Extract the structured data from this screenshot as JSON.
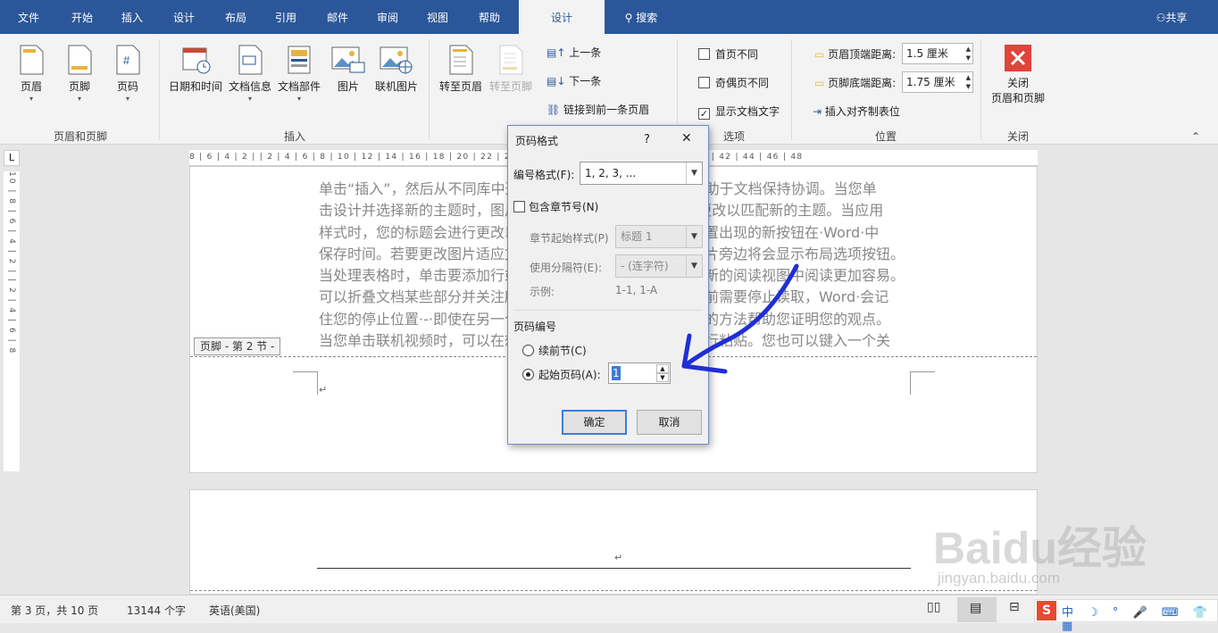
{
  "tabs": [
    "文件",
    "开始",
    "插入",
    "设计",
    "布局",
    "引用",
    "邮件",
    "审阅",
    "视图",
    "帮助",
    "设计"
  ],
  "active_tab_index": 10,
  "search_label": "搜索",
  "share_label": "共享",
  "ribbon": {
    "header_footer": {
      "header": "页眉",
      "footer": "页脚",
      "page_number": "页码",
      "group": "页眉和页脚"
    },
    "insert": {
      "datetime": "日期和时间",
      "docinfo": "文档信息",
      "quickparts": "文档部件",
      "picture": "图片",
      "online_picture": "联机图片",
      "group": "插入"
    },
    "navigation": {
      "goto_header": "转至页眉",
      "goto_footer": "转至页脚",
      "previous": "上一条",
      "next": "下一条",
      "link_previous": "链接到前一条页眉"
    },
    "options": {
      "diff_first": "首页不同",
      "diff_odd_even": "奇偶页不同",
      "show_text": "显示文档文字",
      "group": "选项",
      "show_text_checked": true
    },
    "position": {
      "header_top_label": "页眉顶端距离:",
      "header_top_value": "1.5 厘米",
      "footer_bottom_label": "页脚底端距离:",
      "footer_bottom_value": "1.75 厘米",
      "align_tab": "插入对齐制表位",
      "group": "位置"
    },
    "close": {
      "label1": "关闭",
      "label2": "页眉和页脚",
      "group": "关闭"
    }
  },
  "ruler": "8 | 6 | 4 | 2 |  | 2 | 4 | 6 | 8 | 10 | 12 | 14 | 16 | 18 | 20 | 22 | 24 | 26 | 28 | 30 | 32 | 34 | 36 | 38 | 40 | 42 | 44 | 46 | 48",
  "vruler": "10 | 8 | 6 | 4 | 2 |  | 2 | 4 | 6 | 8",
  "document": {
    "lines": [
      "单击“插入”，然后从不同库中选择所需元素。主题和样式也有助于文档保持协调。当您单",
      "击设计并选择新的主题时，图片、图表或SmartArt图形将会更改以匹配新的主题。当应用",
      "样式时，您的标题会进行更改以匹配新的主题。使用在需要位置出现的新按钮在·Word·中",
      "保存时间。若要更改图片适应文档的方式，请单击该图片，图片旁边将会显示布局选项按钮。",
      "当处理表格时，单击要添加行或列的位置，然后单击加号。在新的阅读视图中阅读更加容易。",
      "可以折叠文档某些部分并关注所需文本。如果在达到结尾处之前需要停止读取，Word·会记",
      "住您的停止位置·-·即使在另一个设备上。视频提供了功能强大的方法帮助您证明您的观点。",
      "当您单击联机视频时，可以在想要添加的视频的嵌入代码中进行粘贴。您也可以键入一个关"
    ],
    "footer_tag": "页脚 - 第 2 节 -",
    "para_mark": "↵"
  },
  "dialog": {
    "title": "页码格式",
    "help": "?",
    "close": "✕",
    "format_label": "编号格式(F):",
    "format_value": "1, 2, 3, ...",
    "include_chapter": "包含章节号(N)",
    "chapter_style_label": "章节起始样式(P)",
    "chapter_style_value": "标题 1",
    "separator_label": "使用分隔符(E):",
    "separator_value": "-  (连字符)",
    "example_label": "示例:",
    "example_value": "1-1, 1-A",
    "numbering_title": "页码编号",
    "continue_label": "续前节(C)",
    "start_at_label": "起始页码(A):",
    "start_at_value": "1",
    "ok": "确定",
    "cancel": "取消"
  },
  "status": {
    "page": "第 3 页，共 10 页",
    "words": "13144 个字",
    "language": "英语(美国)"
  },
  "watermark": {
    "brand": "Baidu经验",
    "url": "jingyan.baidu.com"
  },
  "colors": {
    "brand": "#2b579a",
    "arrow": "#1f2fd6",
    "close_icon": "#e0443a"
  }
}
